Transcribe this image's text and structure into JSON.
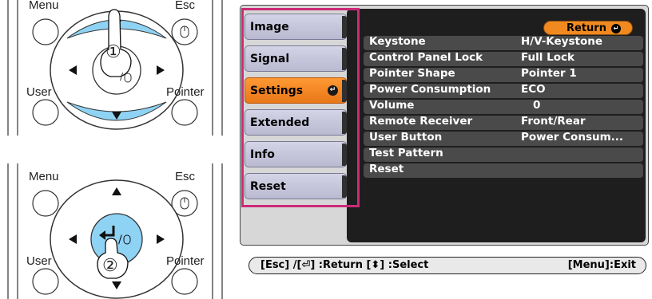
{
  "remote_top": {
    "menu": "Menu",
    "esc": "Esc",
    "user": "User",
    "pointer": "Pointer",
    "step": "①"
  },
  "remote_bottom": {
    "menu": "Menu",
    "esc": "Esc",
    "user": "User",
    "pointer": "Pointer",
    "step": "②"
  },
  "sidebar": {
    "items": [
      {
        "label": "Image"
      },
      {
        "label": "Signal"
      },
      {
        "label": "Settings",
        "active": true
      },
      {
        "label": "Extended"
      },
      {
        "label": "Info"
      },
      {
        "label": "Reset"
      }
    ]
  },
  "return_label": "Return",
  "settings": [
    {
      "label": "Keystone",
      "value": "H/V-Keystone"
    },
    {
      "label": "Control Panel Lock",
      "value": "Full Lock"
    },
    {
      "label": "Pointer Shape",
      "value": "Pointer 1"
    },
    {
      "label": "Power Consumption",
      "value": "ECO"
    },
    {
      "label": "Volume",
      "value": "0"
    },
    {
      "label": "Remote Receiver",
      "value": "Front/Rear"
    },
    {
      "label": "User Button",
      "value": "Power Consum..."
    },
    {
      "label": "Test Pattern",
      "value": ""
    },
    {
      "label": "Reset",
      "value": ""
    }
  ],
  "footer": {
    "left": "[Esc] /[⏎] :Return  [⬍] :Select",
    "right": "[Menu]:Exit"
  },
  "colors": {
    "accent": "#f08a20",
    "highlight_box": "#cc2a77",
    "menu_bg": "#1e1e1e",
    "arrow_blue": "#8fd3f4"
  }
}
